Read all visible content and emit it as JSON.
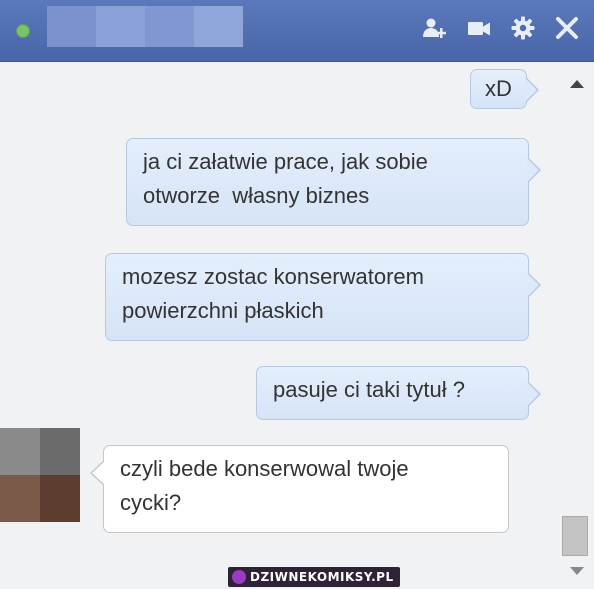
{
  "header": {
    "status": "online",
    "icons": [
      "add-friend-icon",
      "video-call-icon",
      "gear-icon",
      "close-icon"
    ]
  },
  "messages": [
    {
      "from": "me",
      "text": "xD"
    },
    {
      "from": "me",
      "line1": "ja ci załatwie prace, jak sobie",
      "line2": "otworze  własny biznes"
    },
    {
      "from": "me",
      "line1": "mozesz zostac konserwatorem",
      "line2": "powierzchni płaskich"
    },
    {
      "from": "me",
      "text": "pasuje ci taki tytuł ?"
    },
    {
      "from": "them",
      "line1": "czyli bede konserwowal twoje",
      "line2": "cycki?"
    }
  ],
  "watermark": {
    "text": "DZIWNEKOMIKSY.PL"
  }
}
